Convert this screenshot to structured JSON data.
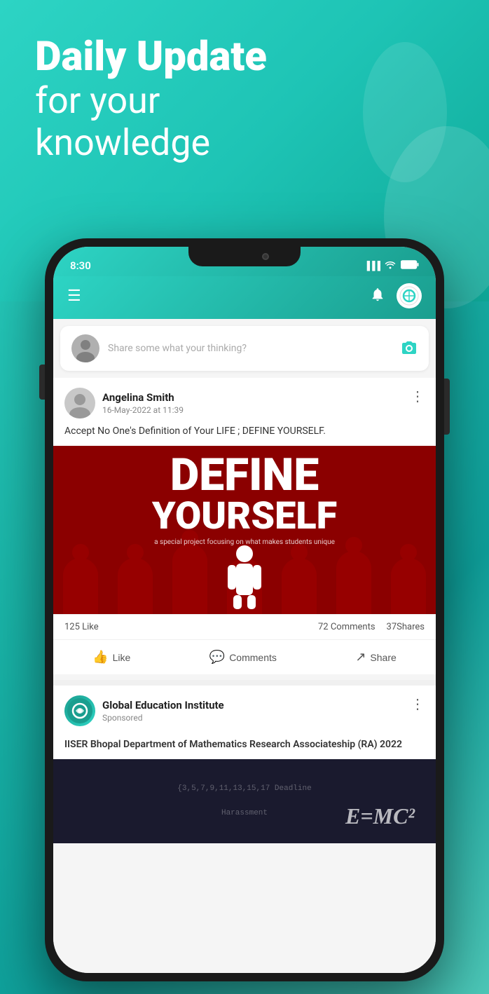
{
  "hero": {
    "title_bold": "Daily Update",
    "title_light_1": "for your",
    "title_light_2": "knowledge"
  },
  "status_bar": {
    "time": "8:30",
    "signal": "▌▌▌",
    "wifi": "wifi",
    "battery": "🔋"
  },
  "app_header": {
    "menu_icon": "☰",
    "bell_icon": "🔔",
    "logo_text": "⊕"
  },
  "composer": {
    "placeholder": "Share some what your thinking?",
    "camera_icon": "📷"
  },
  "post": {
    "author": "Angelina Smith",
    "timestamp": "16-May-2022 at 11:39",
    "text": "Accept No One's Definition of Your LIFE ; DEFINE YOURSELF.",
    "image_line1": "DEFINE",
    "image_line2": "YOURSELF",
    "image_subtitle": "a special project focusing on what makes students unique",
    "likes": "125 Like",
    "comments": "72 Comments",
    "shares": "37Shares",
    "like_btn": "Like",
    "comment_btn": "Comments",
    "share_btn": "Share",
    "more_icon": "⋮"
  },
  "sponsored": {
    "org_name": "Global Education Institute",
    "label": "Sponsored",
    "post_text": "IISER Bhopal Department of Mathematics Research Associateship (RA) 2022",
    "more_icon": "⋮",
    "math_text": "{3,5,7,9,11,13,15,17    Deadline\n\n                            Harassment"
  }
}
